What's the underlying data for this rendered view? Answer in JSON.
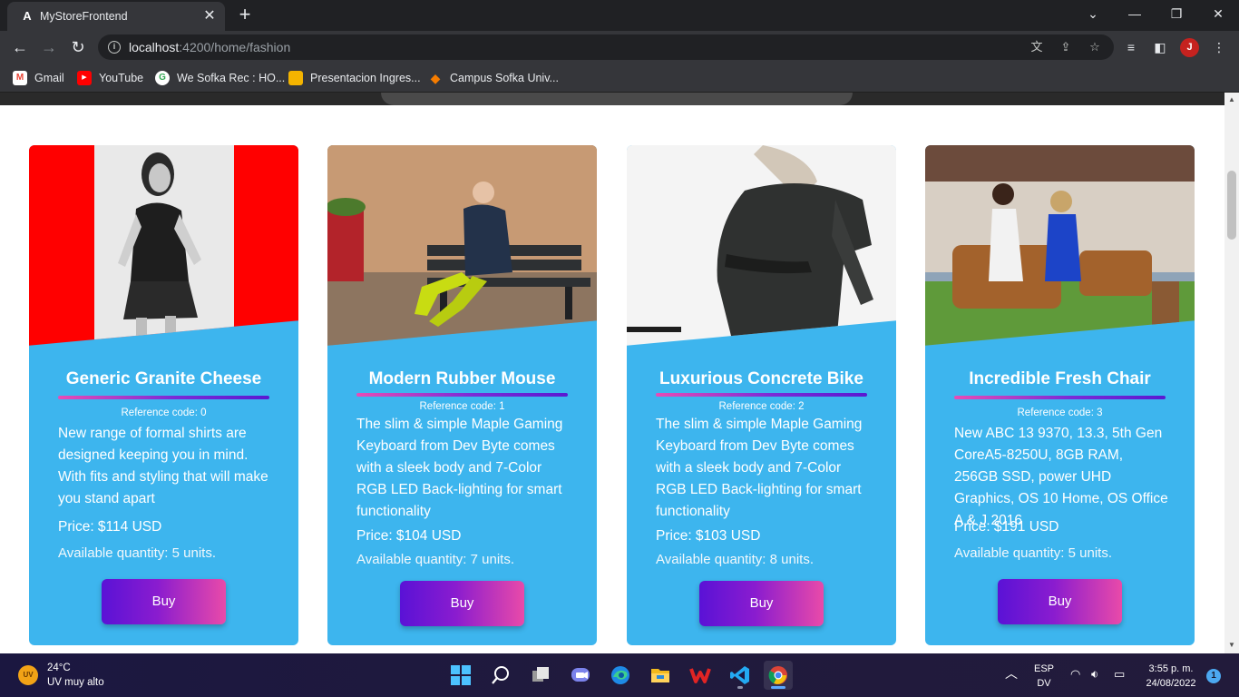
{
  "browser": {
    "tab_title": "MyStoreFrontend",
    "tab_favicon": "A",
    "url_host": "localhost",
    "url_rest": ":4200/home/fashion",
    "profile_initial": "J",
    "bookmarks": [
      {
        "label": "Gmail",
        "icon": "gmail-icon",
        "color": "#ea4335",
        "glyph": "M"
      },
      {
        "label": "YouTube",
        "icon": "youtube-icon",
        "color": "#ff0000",
        "glyph": "▶"
      },
      {
        "label": "We Sofka Rec : HO...",
        "icon": "sofka-icon",
        "color": "#34a853",
        "glyph": "G"
      },
      {
        "label": "Presentacion Ingres...",
        "icon": "slides-icon",
        "color": "#f4b400",
        "glyph": "▭"
      },
      {
        "label": "Campus Sofka Univ...",
        "icon": "campus-icon",
        "color": "#f57c00",
        "glyph": "◆"
      }
    ]
  },
  "products": [
    {
      "title": "Generic Granite Cheese",
      "reference": "Reference code: 0",
      "description": "New range of formal shirts are designed keeping you in mind. With fits and styling that will make you stand apart",
      "price": "Price: $114 USD",
      "quantity": "Available quantity: 5 units.",
      "buy_label": "Buy"
    },
    {
      "title": "Modern Rubber Mouse",
      "reference": "Reference code: 1",
      "description": "The slim & simple Maple Gaming Keyboard from Dev Byte comes with a sleek body and 7-Color RGB LED Back-lighting for smart functionality",
      "price": "Price: $104 USD",
      "quantity": "Available quantity: 7 units.",
      "buy_label": "Buy"
    },
    {
      "title": "Luxurious Concrete Bike",
      "reference": "Reference code: 2",
      "description": "The slim & simple Maple Gaming Keyboard from Dev Byte comes with a sleek body and 7-Color RGB LED Back-lighting for smart functionality",
      "price": "Price: $103 USD",
      "quantity": "Available quantity: 8 units.",
      "buy_label": "Buy"
    },
    {
      "title": "Incredible Fresh Chair",
      "reference": "Reference code: 3",
      "description": "New ABC 13 9370, 13.3, 5th Gen CoreA5-8250U, 8GB RAM, 256GB SSD, power UHD Graphics, OS 10 Home, OS Office A & J 2016",
      "price": "Price: $191 USD",
      "quantity": "Available quantity: 5 units.",
      "buy_label": "Buy"
    }
  ],
  "taskbar": {
    "temperature": "24°C",
    "weather": "UV muy alto",
    "lang_top": "ESP",
    "lang_bottom": "DV",
    "time": "3:55 p. m.",
    "date": "24/08/2022",
    "notifications": "1"
  },
  "colors": {
    "card_bg": "#3db5ee",
    "button_gradient_start": "#5a12d6",
    "button_gradient_end": "#e94aa9"
  }
}
